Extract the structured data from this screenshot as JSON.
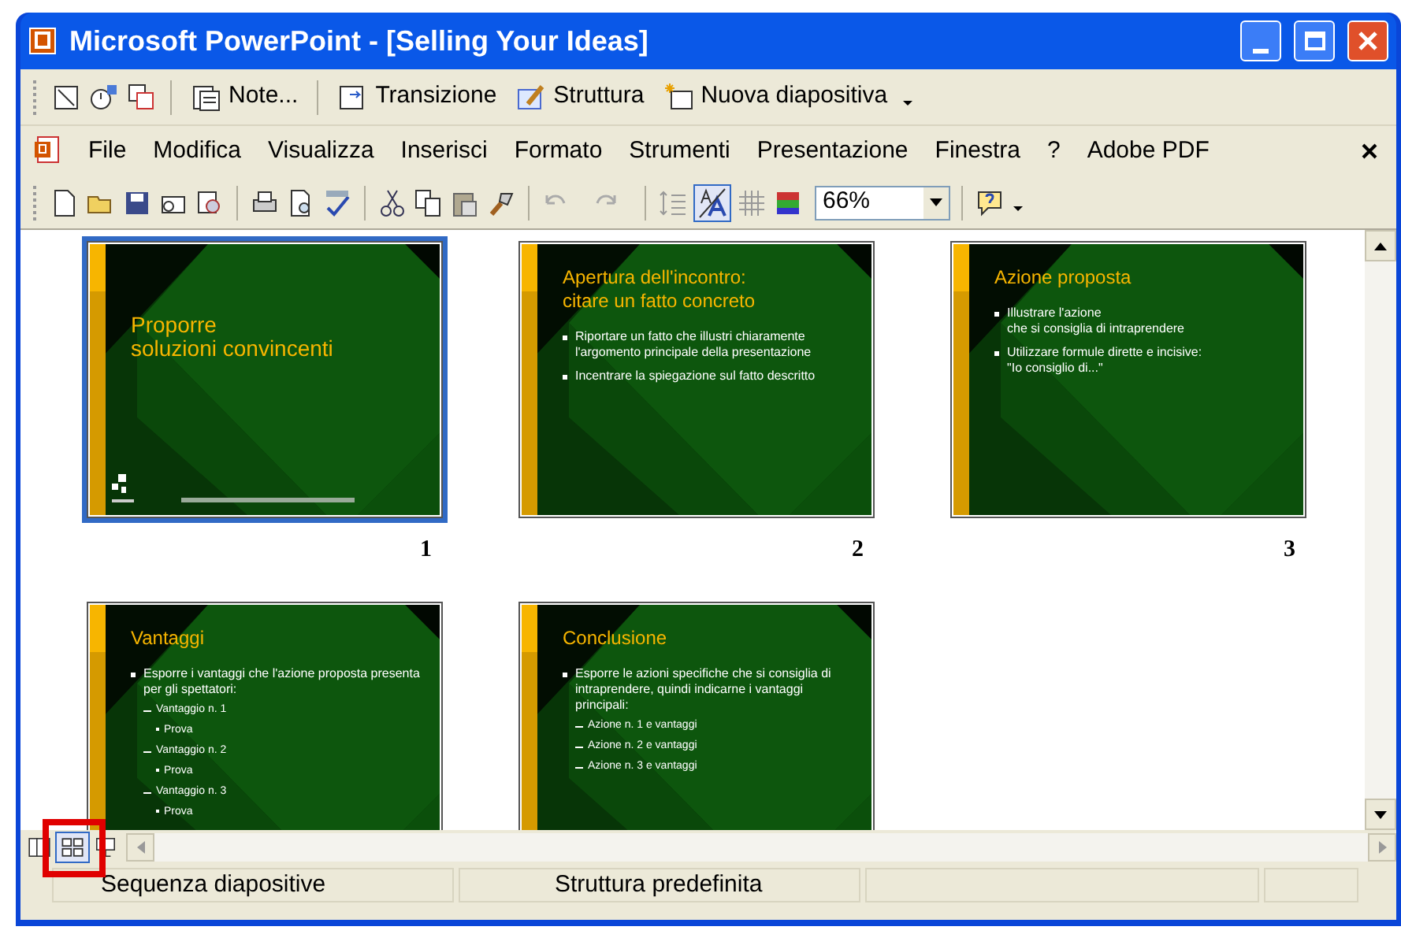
{
  "window": {
    "title": "Microsoft PowerPoint - [Selling Your Ideas]"
  },
  "review_toolbar": [
    {
      "label": "Note..."
    },
    {
      "label": "Transizione"
    },
    {
      "label": "Struttura"
    },
    {
      "label": "Nuova diapositiva"
    }
  ],
  "menu": [
    "File",
    "Modifica",
    "Visualizza",
    "Inserisci",
    "Formato",
    "Strumenti",
    "Presentazione",
    "Finestra",
    "?",
    "Adobe PDF"
  ],
  "standard_toolbar": {
    "format_toggle": {
      "selected": true
    },
    "zoom": {
      "value": "66%"
    }
  },
  "slides": [
    {
      "number": "1",
      "selected": true,
      "title": "Proporre\nsoluzioni convincenti"
    },
    {
      "number": "2",
      "selected": false,
      "title": "Apertura dell'incontro:\ncitare un fatto concreto",
      "bullets": [
        {
          "text": "Riportare un fatto che illustri chiaramente l'argomento principale della presentazione"
        },
        {
          "text": "Incentrare la spiegazione sul fatto descritto"
        }
      ]
    },
    {
      "number": "3",
      "selected": false,
      "title": "Azione proposta",
      "bullets": [
        {
          "text": "Illustrare l'azione\nche si consiglia di intraprendere"
        },
        {
          "text": "Utilizzare formule dirette e incisive:\n\"Io consiglio di...\""
        }
      ]
    },
    {
      "selected": false,
      "title": "Vantaggi",
      "bullets": [
        {
          "text": "Esporre i vantaggi che l'azione proposta presenta per gli spettatori:",
          "children": [
            {
              "text": "Vantaggio n. 1",
              "children": [
                {
                  "text": "Prova"
                }
              ]
            },
            {
              "text": "Vantaggio n. 2",
              "children": [
                {
                  "text": "Prova"
                }
              ]
            },
            {
              "text": "Vantaggio n. 3",
              "children": [
                {
                  "text": "Prova"
                }
              ]
            }
          ]
        }
      ]
    },
    {
      "selected": false,
      "title": "Conclusione",
      "bullets": [
        {
          "text": "Esporre le azioni specifiche che si consiglia di intraprendere, quindi indicarne i vantaggi principali:",
          "children": [
            {
              "text": "Azione n. 1 e vantaggi"
            },
            {
              "text": "Azione n. 2 e vantaggi"
            },
            {
              "text": "Azione n. 3 e vantaggi"
            }
          ]
        }
      ]
    }
  ],
  "view_buttons": [
    {
      "kind": "normal",
      "selected": false
    },
    {
      "kind": "sorter",
      "selected": true
    },
    {
      "kind": "show",
      "selected": false
    }
  ],
  "status_bar": [
    "Sequenza diapositive",
    "Struttura predefinita"
  ]
}
